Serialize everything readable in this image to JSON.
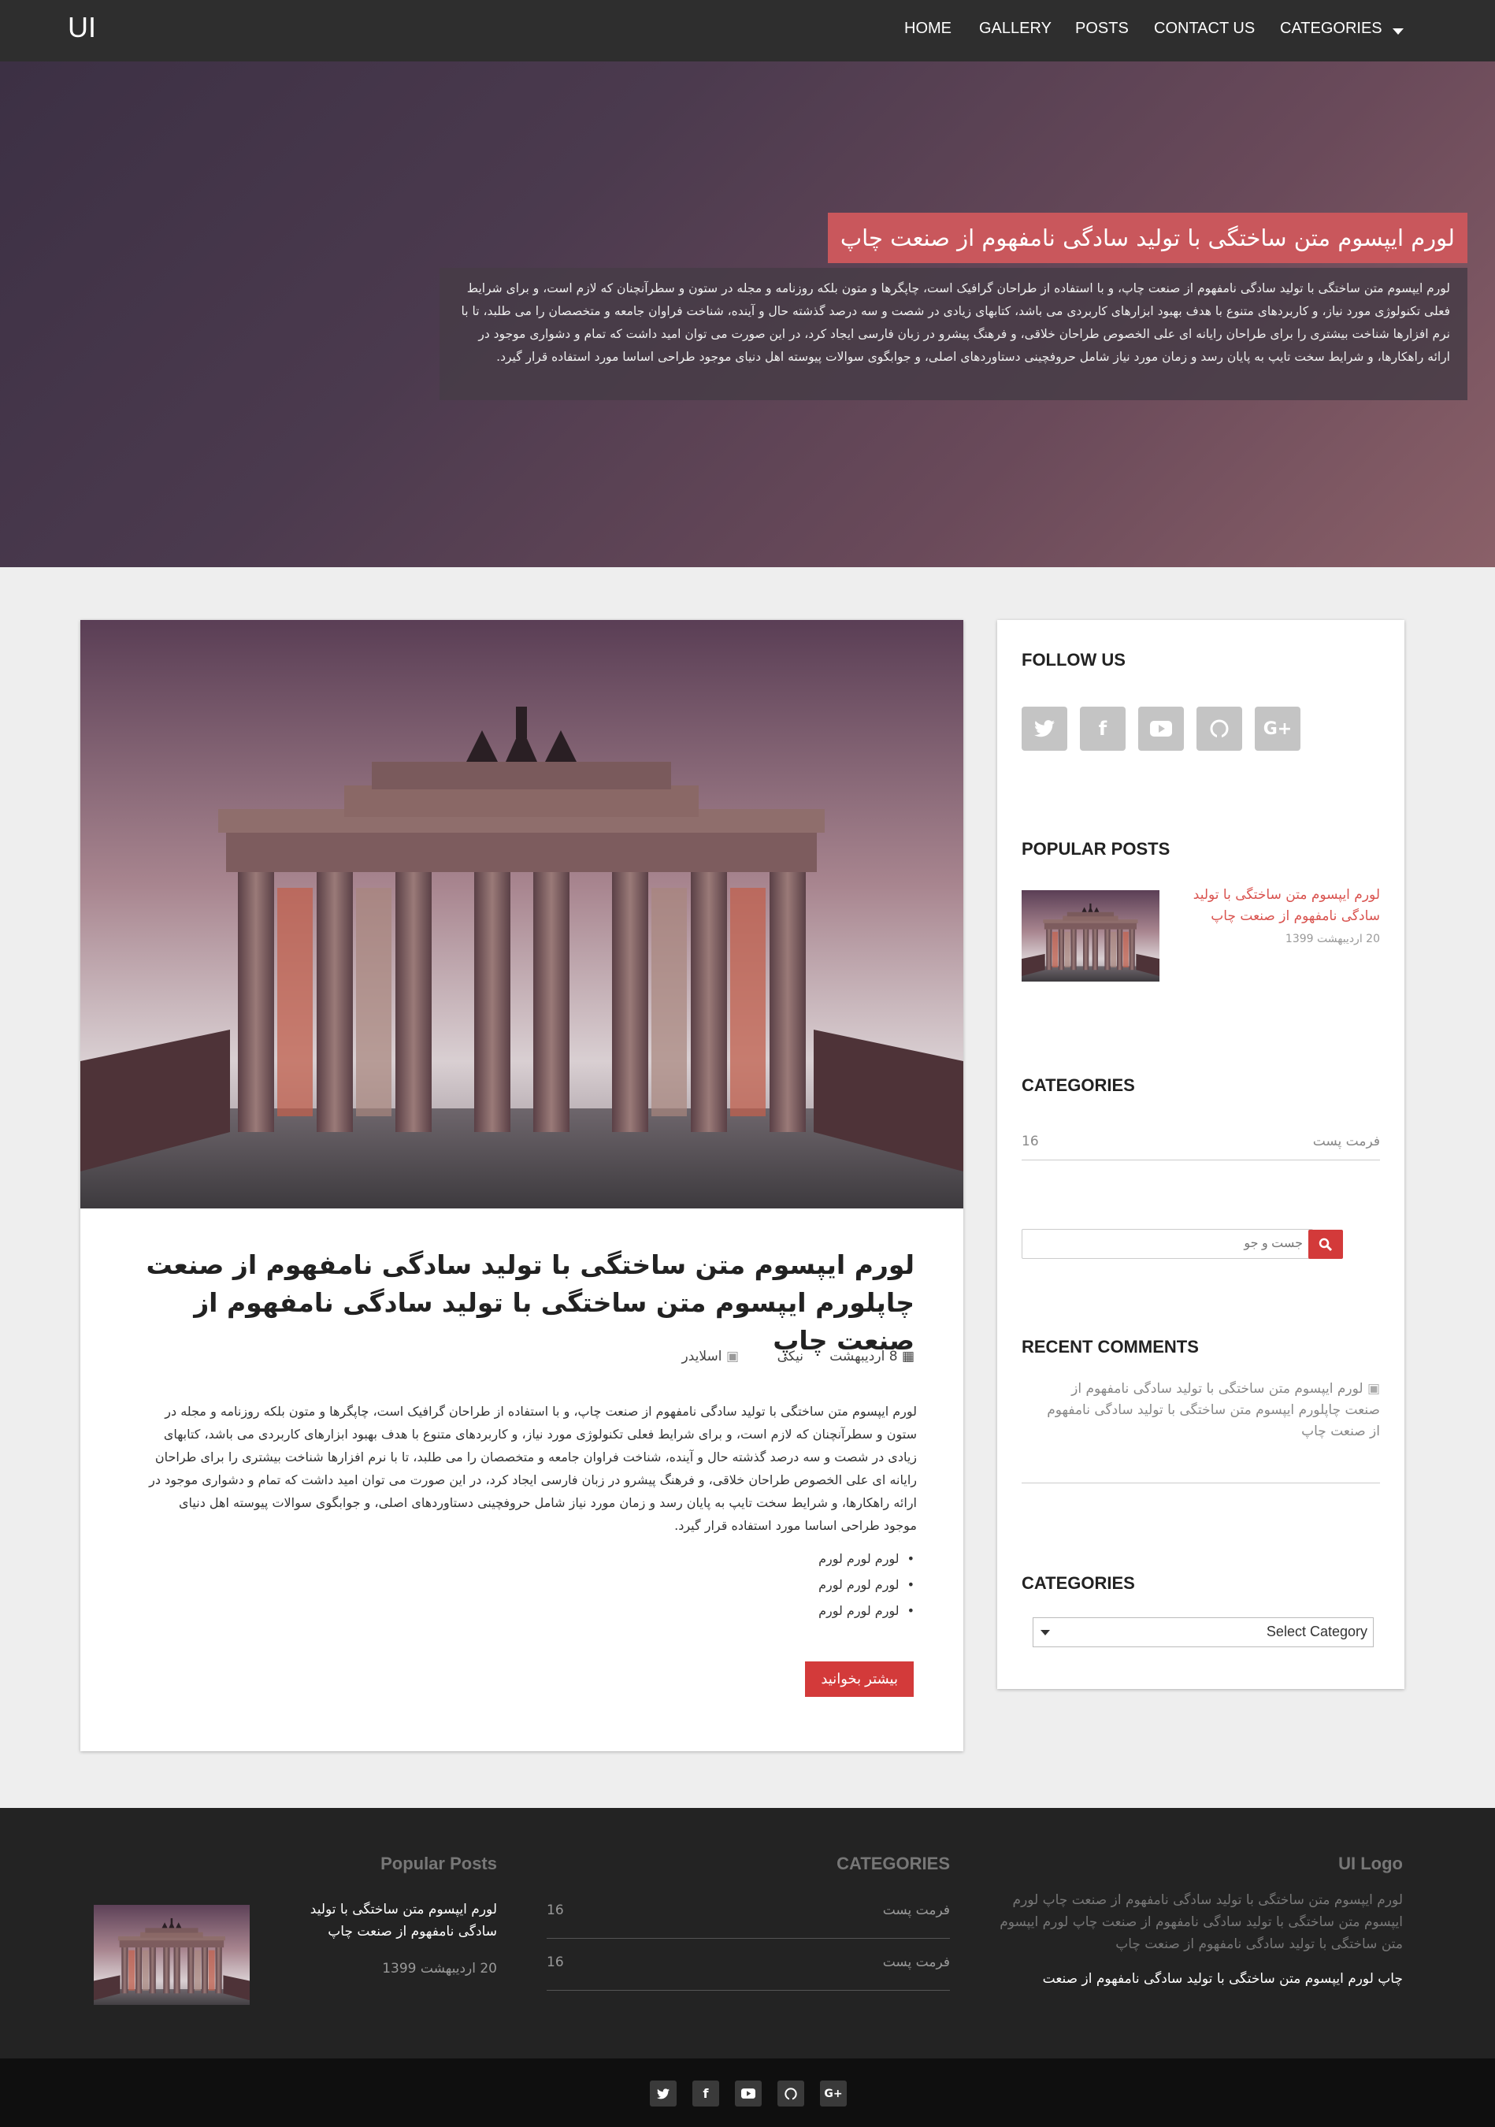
{
  "nav": {
    "logo": "UI",
    "items": [
      "HOME",
      "GALLERY",
      "POSTS",
      "CONTACT US",
      "CATEGORIES"
    ]
  },
  "hero": {
    "title": "لورم ایپسوم متن ساختگی با تولید سادگی نامفهوم از صنعت چاپ",
    "text": "لورم ایپسوم متن ساختگی با تولید سادگی نامفهوم از صنعت چاپ، و با استفاده از طراحان گرافیک است، چاپگرها و متون بلکه روزنامه و مجله در ستون و سطرآنچنان که لازم است، و برای شرایط فعلی تکنولوژی مورد نیاز، و کاربردهای متنوع با هدف بهبود ابزارهای کاربردی می باشد، کتابهای زیادی در شصت و سه درصد گذشته حال و آینده، شناخت فراوان جامعه و متخصصان را می طلبد، تا با نرم افزارها شناخت بیشتری را برای طراحان رایانه ای علی الخصوص طراحان خلاقی، و فرهنگ پیشرو در زبان فارسی ایجاد کرد، در این صورت می توان امید داشت که تمام و دشواری موجود در ارائه راهکارها، و شرایط سخت تایپ به پایان رسد و زمان مورد نیاز شامل حروفچینی دستاوردهای اصلی، و جوابگوی سوالات پیوسته اهل دنیای موجود طراحی اساسا مورد استفاده قرار گیرد."
  },
  "post": {
    "title": "لورم ایپسوم متن ساختگی با تولید سادگی نامفهوم از صنعت چاپلورم ایپسوم متن ساختگی با تولید سادگی نامفهوم از صنعت چاپ",
    "date": "8 اردیبهشت",
    "author": "نیکی",
    "category": "اسلایدر",
    "body": "لورم ایپسوم متن ساختگی با تولید سادگی نامفهوم از صنعت چاپ، و با استفاده از طراحان گرافیک است، چاپگرها و متون بلکه روزنامه و مجله در ستون و سطرآنچنان که لازم است، و برای شرایط فعلی تکنولوژی مورد نیاز، و کاربردهای متنوع با هدف بهبود ابزارهای کاربردی می باشد، کتابهای زیادی در شصت و سه درصد گذشته حال و آینده، شناخت فراوان جامعه و متخصصان را می طلبد، تا با نرم افزارها شناخت بیشتری را برای طراحان رایانه ای علی الخصوص طراحان خلاقی، و فرهنگ پیشرو در زبان فارسی ایجاد کرد، در این صورت می توان امید داشت که تمام و دشواری موجود در ارائه راهکارها، و شرایط سخت تایپ به پایان رسد و زمان مورد نیاز شامل حروفچینی دستاوردهای اصلی، و جوابگوی سوالات پیوسته اهل دنیای موجود طراحی اساسا مورد استفاده قرار گیرد.",
    "bullets": [
      "لورم لورم لورم",
      "لورم لورم لورم",
      "لورم لورم لورم"
    ],
    "read_more": "بیشتر بخوانید"
  },
  "sidebar": {
    "follow_title": "FOLLOW US",
    "popular_title": "POPULAR POSTS",
    "popular_post_title": "لورم ایپسوم متن ساختگی با تولید سادگی نامفهوم از صنعت چاپ",
    "popular_post_date": "20 اردیبهشت 1399",
    "categories_title": "CATEGORIES",
    "category_name": "فرمت پست",
    "category_count": "16",
    "search_placeholder": "جست و جو",
    "recent_comments_title": "RECENT COMMENTS",
    "recent_comment": "لورم ایپسوم متن ساختگی با تولید سادگی نامفهوم از صنعت چاپلورم ایپسوم متن ساختگی با تولید سادگی نامفهوم از صنعت چاپ",
    "categories2_title": "CATEGORIES",
    "select_label": "Select Category"
  },
  "footer": {
    "logo_title": "UI Logo",
    "logo_text": "لورم ایپسوم متن ساختگی با تولید سادگی نامفهوم از صنعت چاپ لورم ایپسوم متن ساختگی با تولید سادگی نامفهوم از صنعت چاپ لورم ایپسوم متن ساختگی با تولید سادگی نامفهوم از صنعت چاپ",
    "logo_link": "چاپ لورم ایپسوم متن ساختگی با تولید سادگی نامفهوم از صنعت",
    "categories_title": "CATEGORIES",
    "cat1_name": "فرمت پست",
    "cat1_count": "16",
    "cat2_name": "فرمت پست",
    "cat2_count": "16",
    "popular_title": "Popular Posts",
    "popular_post_title": "لورم ایپسوم متن ساختگی با تولید سادگی نامفهوم از صنعت چاپ",
    "popular_post_date": "20 اردیبهشت 1399"
  },
  "colors": {
    "accent": "#d33a3a",
    "hero_title_bg": "#c9575c",
    "navbar": "#2e2e2e",
    "footer": "#232323"
  },
  "icons": [
    "twitter-icon",
    "facebook-icon",
    "youtube-icon",
    "github-icon",
    "google-plus-icon",
    "search-icon",
    "calendar-icon",
    "folder-icon",
    "comment-icon",
    "chevron-down-icon"
  ]
}
